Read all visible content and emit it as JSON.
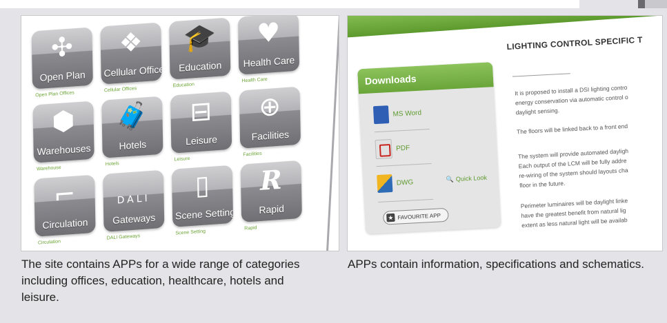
{
  "left_shot": {
    "tiles": [
      {
        "label": "Open Plan",
        "caption": "Open Plan Offices",
        "icon": "open-plan-icon",
        "glyph": "✣"
      },
      {
        "label": "Cellular Offices",
        "caption": "Cellular Offices",
        "icon": "cellular-offices-icon",
        "glyph": "❖"
      },
      {
        "label": "Education",
        "caption": "Education",
        "icon": "graduation-cap-icon",
        "glyph": "🎓"
      },
      {
        "label": "Health Care",
        "caption": "Health Care",
        "icon": "heart-icon",
        "glyph": "♥"
      },
      {
        "label": "Warehouses",
        "caption": "Warehouse",
        "icon": "box-icon",
        "glyph": "⬢"
      },
      {
        "label": "Hotels",
        "caption": "Hotels",
        "icon": "suitcase-icon",
        "glyph": "🧳"
      },
      {
        "label": "Leisure",
        "caption": "Leisure",
        "icon": "pitch-icon",
        "glyph": "⊟"
      },
      {
        "label": "Facilities",
        "caption": "Facilities",
        "icon": "hub-icon",
        "glyph": "⊕"
      },
      {
        "label": "Circulation",
        "caption": "Circulation",
        "icon": "stairs-icon",
        "glyph": "⌐"
      },
      {
        "label": "Gateways",
        "caption": "DALI Gateways",
        "icon": "dali-icon",
        "glyph": "DALI"
      },
      {
        "label": "Scene Setting",
        "caption": "Scene Setting",
        "icon": "remote-icon",
        "glyph": "▯"
      },
      {
        "label": "Rapid",
        "caption": "Rapid",
        "icon": "rapid-r-icon",
        "glyph": "R"
      }
    ]
  },
  "right_shot": {
    "downloads_title": "Downloads",
    "files": [
      {
        "label": "MS Word",
        "icon": "word-file-icon"
      },
      {
        "label": "PDF",
        "icon": "pdf-file-icon"
      },
      {
        "label": "DWG",
        "icon": "dwg-file-icon"
      }
    ],
    "quick_look": "Quick Look",
    "favourite_button": "FAVOURITE APP",
    "content_title": "LIGHTING CONTROL SPECIFIC T",
    "paragraphs": [
      [
        "It is proposed to install a DSI lighting contro",
        "energy conservation via automatic control o",
        "daylight sensing."
      ],
      [
        "The floors will be linked back to a front end"
      ],
      [
        "The system will provide automated dayligh",
        "Each output of the LCM will be fully addre",
        "re-wiring of the system should layouts cha",
        "floor in the future."
      ],
      [
        "Perimeter luminaires will be daylight linke",
        "have the greatest benefit from natural lig",
        "extent as less natural light will be availab"
      ]
    ]
  },
  "captions": {
    "left": "The site contains APPs for a wide range of categories including offices, education, healthcare, hotels and leisure.",
    "right": "APPs contain information, specifications and schematics."
  },
  "colors": {
    "accent_green": "#6aa335",
    "panel_bg": "#e4e4e8",
    "tile_grey": "#8b8b90"
  }
}
